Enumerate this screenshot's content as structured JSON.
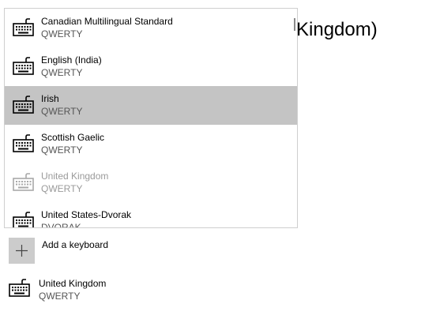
{
  "page": {
    "title_partial": "d Kingdom)"
  },
  "dropdown": {
    "items": [
      {
        "name": "Canadian Multilingual Standard",
        "layout": "QWERTY",
        "state": "normal"
      },
      {
        "name": "English (India)",
        "layout": "QWERTY",
        "state": "normal"
      },
      {
        "name": "Irish",
        "layout": "QWERTY",
        "state": "selected"
      },
      {
        "name": "Scottish Gaelic",
        "layout": "QWERTY",
        "state": "normal"
      },
      {
        "name": "United Kingdom",
        "layout": "QWERTY",
        "state": "disabled"
      },
      {
        "name": "United States-Dvorak",
        "layout": "DVORAK",
        "state": "normal"
      }
    ]
  },
  "add_keyboard": {
    "label": "Add a keyboard",
    "icon": "plus-icon"
  },
  "installed": {
    "name": "United Kingdom",
    "layout": "QWERTY",
    "icon": "keyboard-icon"
  },
  "colors": {
    "selected_bg": "#c4c4c4",
    "add_button_bg": "#cccccc",
    "disabled_text": "#9a9a9a"
  }
}
